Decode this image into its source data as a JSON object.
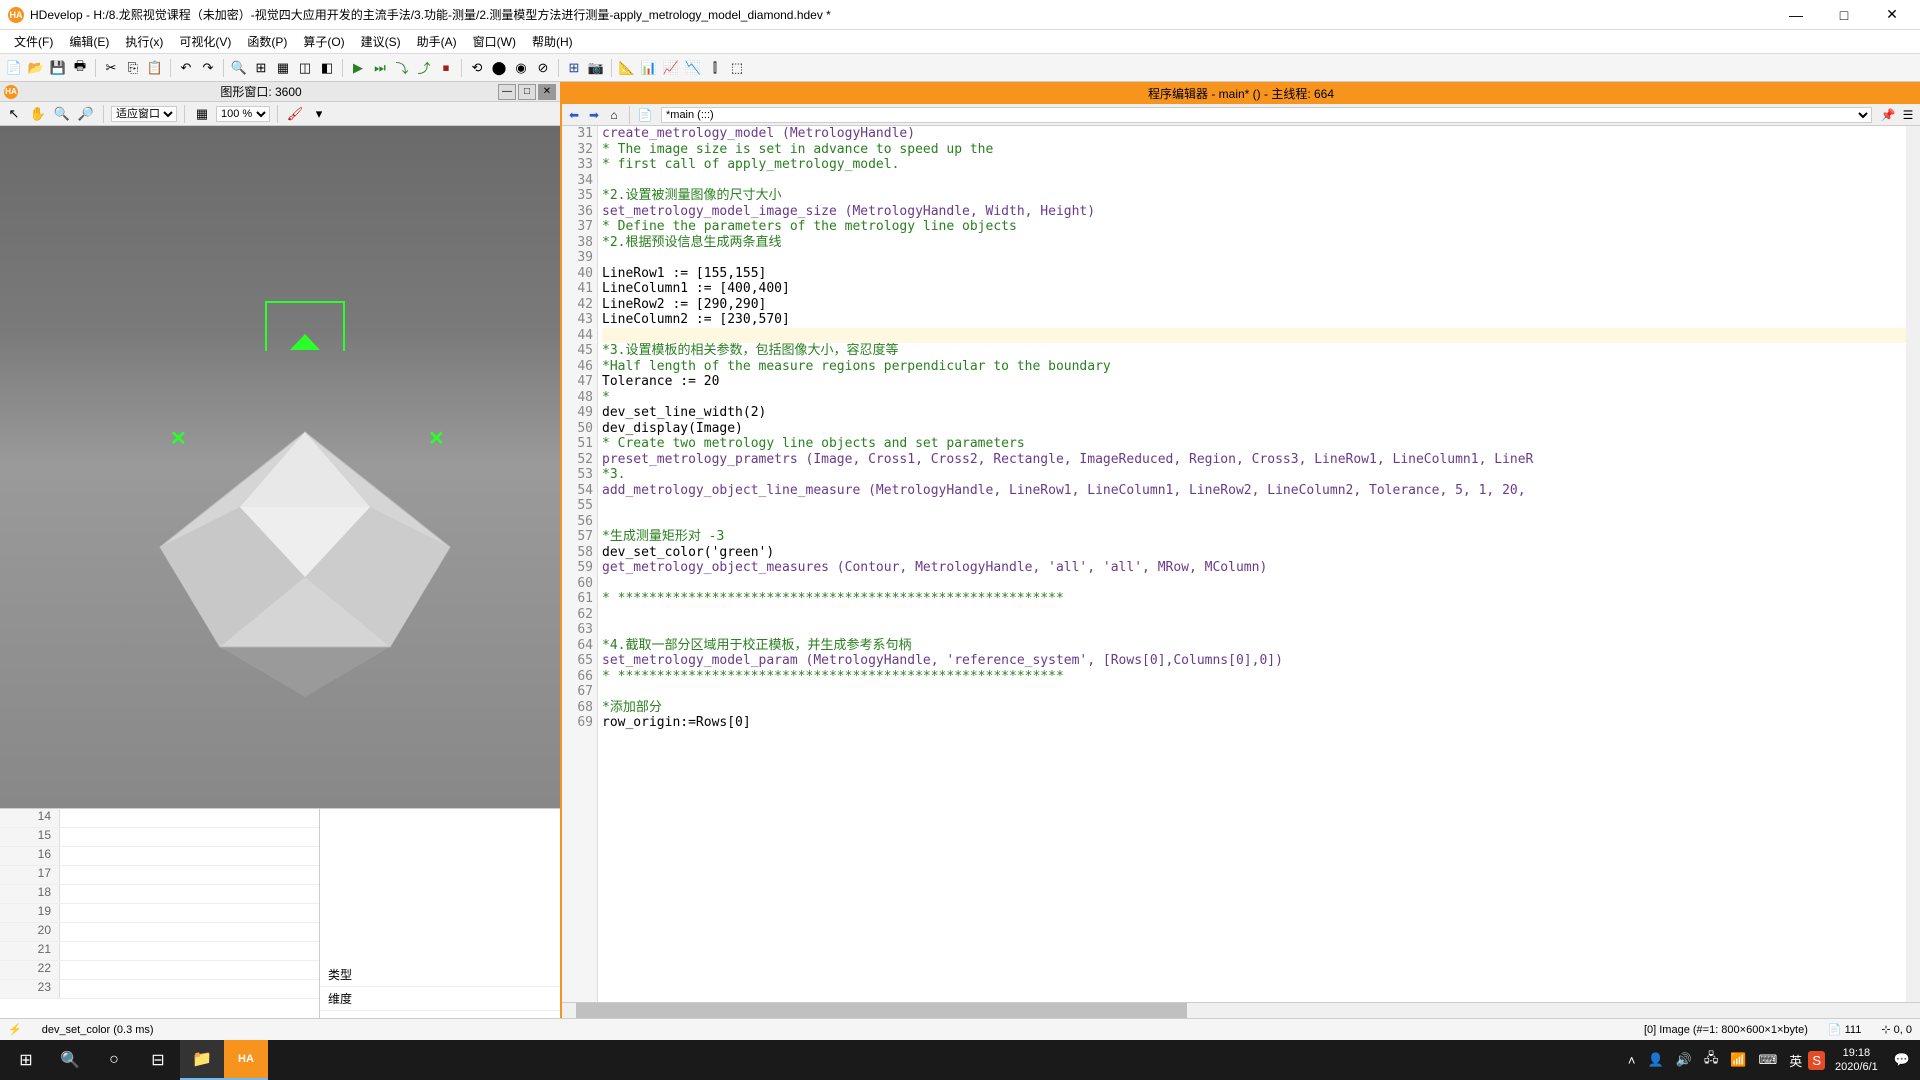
{
  "titlebar": {
    "text": "HDevelop - H:/8.龙熙视觉课程（未加密）-视觉四大应用开发的主流手法/3.功能-测量/2.测量模型方法进行测量-apply_metrology_model_diamond.hdev *",
    "icon_label": "HA"
  },
  "menu": {
    "items": [
      "文件(F)",
      "编辑(E)",
      "执行(x)",
      "可视化(V)",
      "函数(P)",
      "算子(O)",
      "建议(S)",
      "助手(A)",
      "窗口(W)",
      "帮助(H)"
    ]
  },
  "img_window": {
    "title": "图形窗口: 3600",
    "zoom": "100 %",
    "fit_label": "适应窗口"
  },
  "table_nums": [
    "14",
    "15",
    "16",
    "17",
    "18",
    "19",
    "20",
    "21",
    "22",
    "23"
  ],
  "table_right": {
    "type": "类型",
    "dim": "维度"
  },
  "code_header": "程序编辑器 - main* () - 主线程: 664",
  "code_dropdown": "*main (:::)",
  "code": {
    "start": 31,
    "lines": [
      {
        "n": 31,
        "t": "call",
        "s": "create_metrology_model (MetrologyHandle)"
      },
      {
        "n": 32,
        "t": "comment",
        "s": "* The image size is set in advance to speed up the"
      },
      {
        "n": 33,
        "t": "comment",
        "s": "* first call of apply_metrology_model."
      },
      {
        "n": 34,
        "t": "code",
        "s": ""
      },
      {
        "n": 35,
        "t": "comment",
        "s": "*2.设置被测量图像的尺寸大小"
      },
      {
        "n": 36,
        "t": "call",
        "s": "set_metrology_model_image_size (MetrologyHandle, Width, Height)"
      },
      {
        "n": 37,
        "t": "comment",
        "s": "* Define the parameters of the metrology line objects"
      },
      {
        "n": 38,
        "t": "comment",
        "s": "*2.根据预设信息生成两条直线"
      },
      {
        "n": 39,
        "t": "code",
        "s": ""
      },
      {
        "n": 40,
        "t": "code",
        "s": "LineRow1 := [155,155]"
      },
      {
        "n": 41,
        "t": "code",
        "s": "LineColumn1 := [400,400]"
      },
      {
        "n": 42,
        "t": "code",
        "s": "LineRow2 := [290,290]"
      },
      {
        "n": 43,
        "t": "code",
        "s": "LineColumn2 := [230,570]"
      },
      {
        "n": 44,
        "t": "hl",
        "s": ""
      },
      {
        "n": 45,
        "t": "comment",
        "s": "*3.设置模板的相关参数，包括图像大小，容忍度等"
      },
      {
        "n": 46,
        "t": "comment",
        "s": "*Half length of the measure regions perpendicular to the boundary"
      },
      {
        "n": 47,
        "t": "code",
        "s": "Tolerance := 20"
      },
      {
        "n": 48,
        "t": "comment",
        "s": "*"
      },
      {
        "n": 49,
        "t": "code",
        "s": "dev_set_line_width(2)"
      },
      {
        "n": 50,
        "t": "code",
        "s": "dev_display(Image)"
      },
      {
        "n": 51,
        "t": "comment",
        "s": "* Create two metrology line objects and set parameters"
      },
      {
        "n": 52,
        "t": "call",
        "s": "preset_metrology_prametrs (Image, Cross1, Cross2, Rectangle, ImageReduced, Region, Cross3, LineRow1, LineColumn1, LineR"
      },
      {
        "n": 53,
        "t": "comment",
        "s": "*3."
      },
      {
        "n": 54,
        "t": "call",
        "s": "add_metrology_object_line_measure (MetrologyHandle, LineRow1, LineColumn1, LineRow2, LineColumn2, Tolerance, 5, 1, 20, "
      },
      {
        "n": 55,
        "t": "code",
        "s": ""
      },
      {
        "n": 56,
        "t": "code",
        "s": ""
      },
      {
        "n": 57,
        "t": "comment",
        "s": "*生成测量矩形对 -3"
      },
      {
        "n": 58,
        "t": "code",
        "s": "dev_set_color('green')"
      },
      {
        "n": 59,
        "t": "call",
        "s": "get_metrology_object_measures (Contour, MetrologyHandle, 'all', 'all', MRow, MColumn)"
      },
      {
        "n": 60,
        "t": "code",
        "s": ""
      },
      {
        "n": 61,
        "t": "comment",
        "s": "* *********************************************************"
      },
      {
        "n": 62,
        "t": "code",
        "s": ""
      },
      {
        "n": 63,
        "t": "code",
        "s": ""
      },
      {
        "n": 64,
        "t": "comment",
        "s": "*4.截取一部分区域用于校正模板，并生成参考系句柄"
      },
      {
        "n": 65,
        "t": "call",
        "s": "set_metrology_model_param (MetrologyHandle, 'reference_system', [Rows[0],Columns[0],0])"
      },
      {
        "n": 66,
        "t": "comment",
        "s": "* *********************************************************"
      },
      {
        "n": 67,
        "t": "code",
        "s": ""
      },
      {
        "n": 68,
        "t": "comment",
        "s": "*添加部分"
      },
      {
        "n": 69,
        "t": "code",
        "s": "row_origin:=Rows[0]"
      }
    ]
  },
  "status": {
    "left": "dev_set_color (0.3 ms)",
    "image_info": "[0] Image (#=1: 800×600×1×byte)",
    "line": "111",
    "pos": "0, 0"
  },
  "taskbar": {
    "time": "19:18",
    "date": "2020/6/1",
    "lang": "英"
  }
}
